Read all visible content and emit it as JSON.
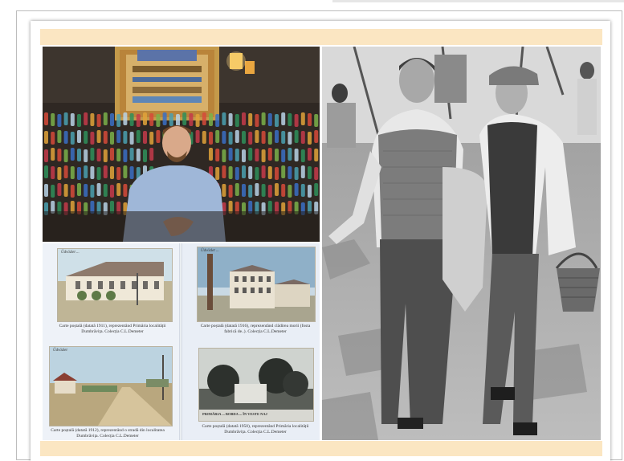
{
  "photos": {
    "bottles": {
      "subject": "Man in bow tie seated before a wall of colored bottles under a tapestry"
    },
    "postcards": {
      "subject": "Open booklet of historical postcards",
      "captions": [
        "Carte poștală (datată 1911), reprezentând Primăria localității Dumbrăvița. Colecția C.L.Demeter",
        "Carte poștală (datată 1916), reprezentând clădirea morii (fosta fabrică de..). Colecția C.L.Demeter",
        "Carte poștală (datată 1912), reprezentând o stradă din localitatea Dumbrăvița. Colecția C.L.Demeter",
        "Carte poștală (datată 1950), reprezentând Primăria localității Dumbrăvița. Colecția C.L.Demeter"
      ],
      "card_texts": {
        "top_left_sign": "Üdvözlet ...",
        "top_right_sign": "Üdvözlet ...",
        "bottom_left_sign": "Üdvözlet",
        "bottom_right_sign": "PRIMĂRIA ... BOBDA ... ÎN VESTE NAJ"
      }
    },
    "men": {
      "subject": "Black and white photo of two older men walking, one carrying a basket"
    }
  }
}
